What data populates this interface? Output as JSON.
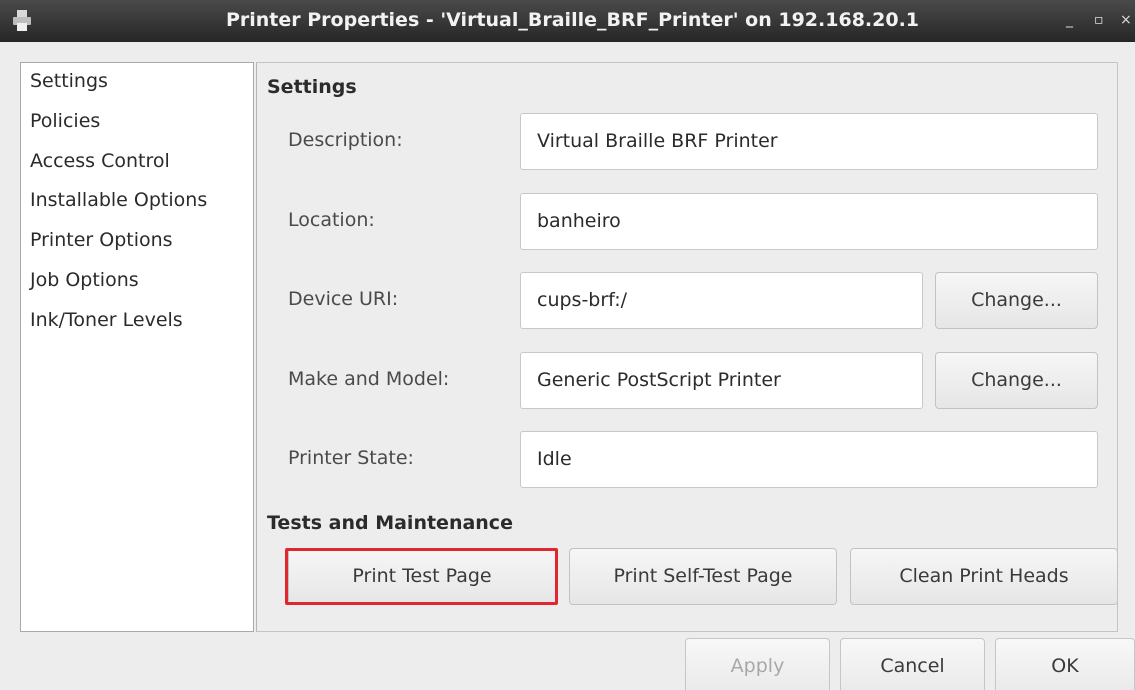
{
  "window": {
    "title": "Printer Properties - 'Virtual_Braille_BRF_Printer' on 192.168.20.1",
    "minimize": "_",
    "maximize": "▫",
    "close": "×"
  },
  "sidebar": {
    "items": [
      {
        "label": "Settings"
      },
      {
        "label": "Policies"
      },
      {
        "label": "Access Control"
      },
      {
        "label": "Installable Options"
      },
      {
        "label": "Printer Options"
      },
      {
        "label": "Job Options"
      },
      {
        "label": "Ink/Toner Levels"
      }
    ]
  },
  "settings": {
    "heading": "Settings",
    "description": {
      "label": "Description:",
      "value": "Virtual Braille BRF Printer"
    },
    "location": {
      "label": "Location:",
      "value": "banheiro"
    },
    "device_uri": {
      "label": "Device URI:",
      "value": "cups-brf:/",
      "change_label": "Change..."
    },
    "make_model": {
      "label": "Make and Model:",
      "value": "Generic PostScript Printer",
      "change_label": "Change..."
    },
    "printer_state": {
      "label": "Printer State:",
      "value": "Idle"
    }
  },
  "maintenance": {
    "heading": "Tests and Maintenance",
    "print_test_page": "Print Test Page",
    "print_self_test_page": "Print Self-Test Page",
    "clean_print_heads": "Clean Print Heads"
  },
  "dialog_buttons": {
    "apply": "Apply",
    "cancel": "Cancel",
    "ok": "OK"
  },
  "colors": {
    "highlight": "#e0262f",
    "titlebar": "#2f2f2f"
  },
  "icons": {
    "title_icon": "printer-icon"
  }
}
